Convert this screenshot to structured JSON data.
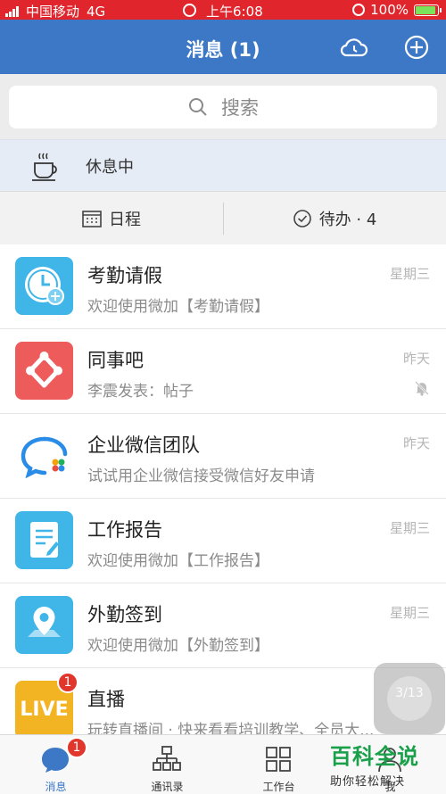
{
  "status_bar": {
    "carrier": "中国移动",
    "network": "4G",
    "time": "上午6:08",
    "battery": "100%"
  },
  "nav": {
    "title": "消息 (1)"
  },
  "search": {
    "placeholder": "搜索"
  },
  "presence": {
    "label": "休息中"
  },
  "tabs": [
    {
      "label": "日程"
    },
    {
      "label": "待办 · 4"
    }
  ],
  "messages": [
    {
      "name": "考勤请假",
      "preview": "欢迎使用微加【考勤请假】",
      "time": "星期三",
      "icon": "clock-icon"
    },
    {
      "name": "同事吧",
      "preview": "李震发表：帖子",
      "time": "昨天",
      "icon": "colleague-icon",
      "muted": true
    },
    {
      "name": "企业微信团队",
      "preview": "试试用企业微信接受微信好友申请",
      "time": "昨天",
      "icon": "wework-icon"
    },
    {
      "name": "工作报告",
      "preview": "欢迎使用微加【工作报告】",
      "time": "星期三",
      "icon": "report-icon"
    },
    {
      "name": "外勤签到",
      "preview": "欢迎使用微加【外勤签到】",
      "time": "星期三",
      "icon": "location-icon"
    },
    {
      "name": "直播",
      "preview": "玩转直播间 · 快来看看培训教学、全员大...",
      "time": "",
      "icon": "live-icon",
      "badge": "1",
      "avatar_text": "LIVE"
    }
  ],
  "floater": {
    "label": "3/13"
  },
  "tabbar": [
    {
      "label": "消息",
      "badge": "1"
    },
    {
      "label": "通讯录"
    },
    {
      "label": "工作台"
    },
    {
      "label": "我"
    }
  ],
  "watermark": {
    "title": "百科全说",
    "subtitle": "助你轻松解决"
  },
  "colors": {
    "nav": "#3c78c5",
    "status_bar": "#e0262c",
    "active_tab": "#3c78c5"
  }
}
